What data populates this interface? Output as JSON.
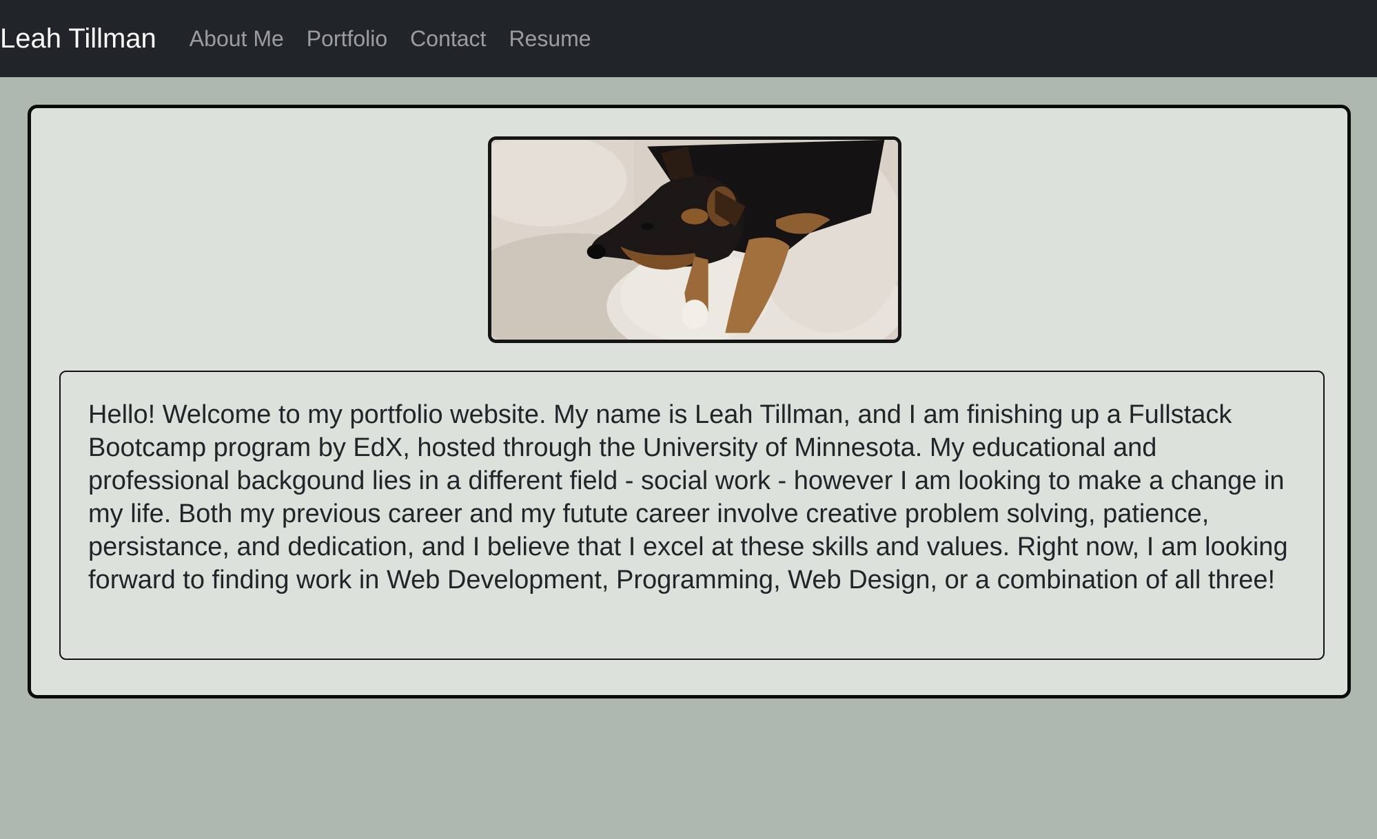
{
  "navbar": {
    "brand": "Leah Tillman",
    "links": [
      {
        "label": "About Me"
      },
      {
        "label": "Portfolio"
      },
      {
        "label": "Contact"
      },
      {
        "label": "Resume"
      }
    ]
  },
  "about": {
    "photo_subject": "dog-photo",
    "bio": "Hello! Welcome to my portfolio website. My name is Leah Tillman, and I am finishing up a Fullstack Bootcamp program by EdX, hosted through the University of Minnesota. My educational and professional backgound lies in a different field - social work - however I am looking to make a change in my life. Both my previous career and my futute career involve creative problem solving, patience, persistance, and dedication, and I believe that I excel at these skills and values. Right now, I am looking forward to finding work in Web Development, Programming, Web Design, or a combination of all three!"
  },
  "colors": {
    "navbar_bg": "#212529",
    "page_bg": "#aeb8ae",
    "card_bg": "#dce1dc",
    "text": "#212529"
  }
}
